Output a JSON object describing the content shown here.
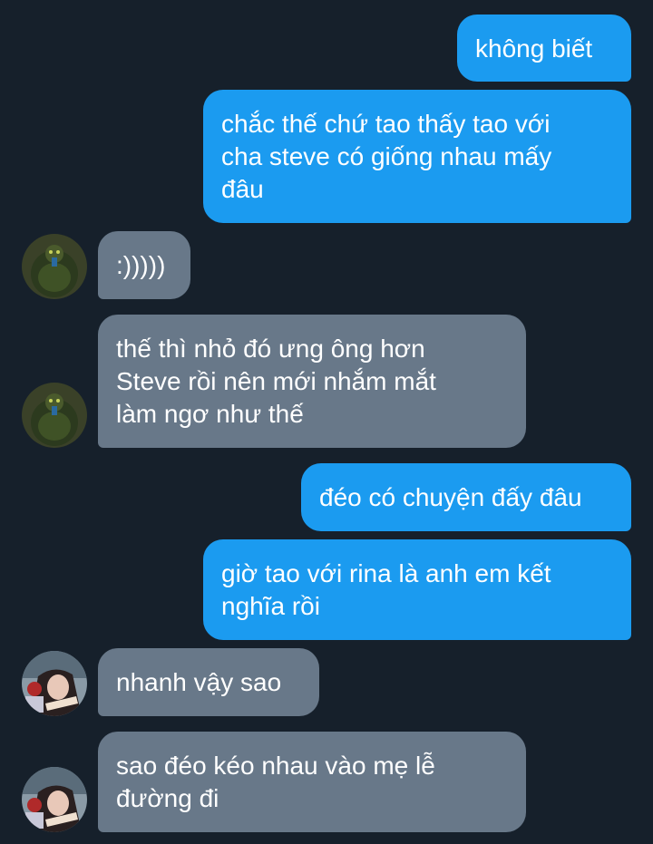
{
  "messages": [
    {
      "from": "me",
      "text": "không biết"
    },
    {
      "from": "me",
      "text": "chắc thế chứ tao thấy tao với\ncha steve có giống nhau mấy\nđâu"
    },
    {
      "from": "other",
      "avatar": "green-figure-avatar",
      "text": ":)))))"
    },
    {
      "from": "other",
      "avatar": "green-figure-avatar",
      "text": "thế thì nhỏ đó ưng ông hơn\nSteve rồi nên mới nhắm mắt\nlàm ngơ như thế"
    },
    {
      "from": "me",
      "text": "đéo có chuyện đấy đâu"
    },
    {
      "from": "me",
      "text": "giờ tao với rina là anh em kết\nnghĩa rồi"
    },
    {
      "from": "other",
      "avatar": "anime-figure-avatar",
      "text": "nhanh vậy sao"
    },
    {
      "from": "other",
      "avatar": "anime-figure-avatar",
      "text": "sao đéo kéo nhau vào mẹ lễ\nđường đi"
    }
  ],
  "colors": {
    "background": "#16202b",
    "outgoing_bubble": "#1b9bf0",
    "incoming_bubble": "#687889",
    "text": "#ffffff"
  }
}
